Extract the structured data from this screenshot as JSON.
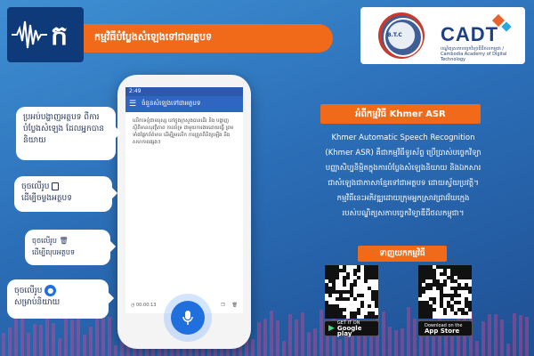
{
  "header": {
    "title_khmer": "កម្មវិធីបំប្លែងសំឡេងទៅជាអត្ថបទ",
    "org_name": "CADT",
    "org_subtitle": "បណ្ឌិត្យសភាបច្ចេកវិទ្យាឌីជីថលកម្ពុជា / Cambodia Academy of Digital Technology",
    "seal_text": "B.T.C"
  },
  "phone": {
    "status_time": "2:49",
    "app_title": "ចំនួនសំឡេងទៅជាអត្ថបទ",
    "transcribed_text": "លើកទេខ្ញុំជាមនុស្ស នៅក្នុងក្រសួងបានដើរ និង បង្ហាញស្ថិតិមានសុវត្ថិភាព ការគាំទ្រ ជាមួយការងារដោយធ្វើ ព្រមទាំងផ្នែកព័ត៌មាន ដើម្បីរួមលើក ការត្រួតពិនិត្យឡើង និងសហការផ្សេងៗ",
    "timer": "00:00:13"
  },
  "bubbles": {
    "b1": "ប្រអប់បង្ហាញអត្ថបទ ពីការបំប្លែងសំឡេង ដែលអ្នកបាននិយាយ",
    "b2_line1": "ចុចលើរូប",
    "b2_line2": "ដើម្បីចម្លងអត្ថបទ",
    "b3_line1": "ចុចលើរូប",
    "b3_line2": "ដើម្បីលុបអត្ថបទ",
    "b4_line1": "ចុចលើរូប",
    "b4_line2": "សម្រាប់និយាយ"
  },
  "about": {
    "title": "អំពីកម្មវិធី Khmer ASR",
    "line1": "Khmer Automatic Speech Recognition",
    "line2": "(Khmer ASR) គឺជាកម្មវិធីទូរស័ព្ទ ប្រើប្រាស់បច្ចេកវិទ្យា",
    "line3": "បញ្ញាសិប្បនិម្មិតក្នុងការបំប្លែងសំឡេងនិយាយ និងឯកសារ",
    "line4": "ជាសំឡេងជាភាសាខ្មែរទៅជាអត្ថបទ ដោយស្វ័យប្រវត្តិ។",
    "line5": "កម្មវិធីនេះអភិវឌ្ឍដោយក្រុមអ្នកស្រាវជ្រាវវ័យក្មេង",
    "line6": "របស់បណ្ឌិត្យសភាបច្ចេកវិទ្យាឌីជីថលកម្ពុជា។"
  },
  "download": {
    "title": "ទាញយកកម្មវិធី",
    "google_small": "GET IT ON",
    "google_big": "Google play",
    "apple_small": "Download on the",
    "apple_big": "App Store"
  },
  "colors": {
    "accent_orange": "#f06a1a",
    "app_blue": "#2f66c1",
    "background_blue": "#2b6fb8"
  }
}
